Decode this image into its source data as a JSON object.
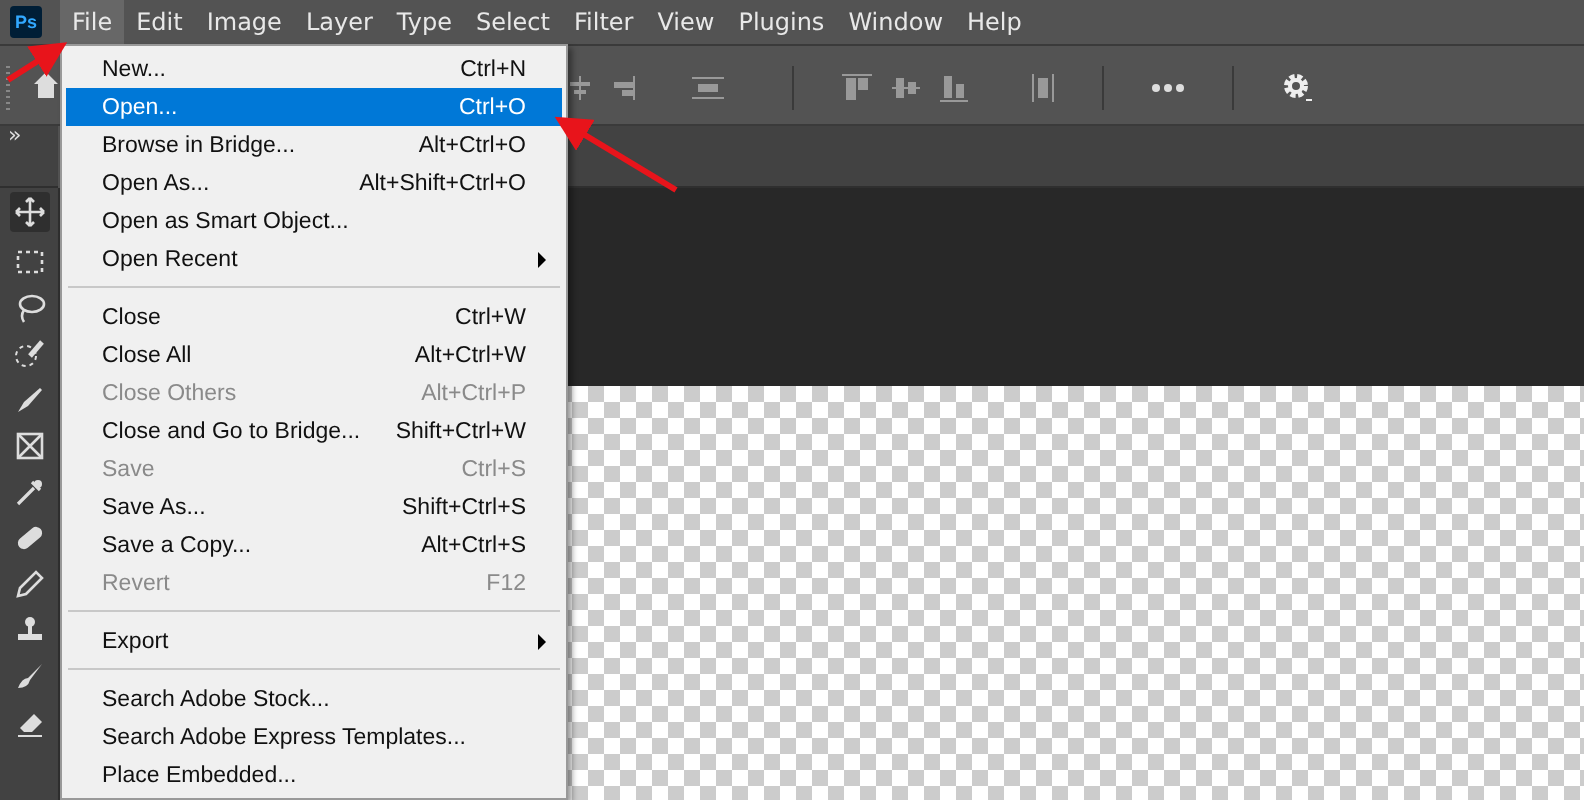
{
  "menubar": [
    {
      "label": "File",
      "selected": true
    },
    {
      "label": "Edit",
      "selected": false
    },
    {
      "label": "Image",
      "selected": false
    },
    {
      "label": "Layer",
      "selected": false
    },
    {
      "label": "Type",
      "selected": false
    },
    {
      "label": "Select",
      "selected": false
    },
    {
      "label": "Filter",
      "selected": false
    },
    {
      "label": "View",
      "selected": false
    },
    {
      "label": "Plugins",
      "selected": false
    },
    {
      "label": "Window",
      "selected": false
    },
    {
      "label": "Help",
      "selected": false
    }
  ],
  "app_logo": "Ps",
  "panel_toggle": "»",
  "file_menu": [
    {
      "kind": "item",
      "label": "New...",
      "shortcut": "Ctrl+N",
      "selected": false,
      "disabled": false
    },
    {
      "kind": "item",
      "label": "Open...",
      "shortcut": "Ctrl+O",
      "selected": true,
      "disabled": false
    },
    {
      "kind": "item",
      "label": "Browse in Bridge...",
      "shortcut": "Alt+Ctrl+O",
      "selected": false,
      "disabled": false
    },
    {
      "kind": "item",
      "label": "Open As...",
      "shortcut": "Alt+Shift+Ctrl+O",
      "selected": false,
      "disabled": false
    },
    {
      "kind": "item",
      "label": "Open as Smart Object...",
      "selected": false,
      "disabled": false
    },
    {
      "kind": "submenu",
      "label": "Open Recent",
      "selected": false,
      "disabled": false
    },
    {
      "kind": "separator"
    },
    {
      "kind": "item",
      "label": "Close",
      "shortcut": "Ctrl+W",
      "selected": false,
      "disabled": false
    },
    {
      "kind": "item",
      "label": "Close All",
      "shortcut": "Alt+Ctrl+W",
      "selected": false,
      "disabled": false
    },
    {
      "kind": "item",
      "label": "Close Others",
      "shortcut": "Alt+Ctrl+P",
      "selected": false,
      "disabled": true
    },
    {
      "kind": "item",
      "label": "Close and Go to Bridge...",
      "shortcut": "Shift+Ctrl+W",
      "selected": false,
      "disabled": false
    },
    {
      "kind": "item",
      "label": "Save",
      "shortcut": "Ctrl+S",
      "selected": false,
      "disabled": true
    },
    {
      "kind": "item",
      "label": "Save As...",
      "shortcut": "Shift+Ctrl+S",
      "selected": false,
      "disabled": false
    },
    {
      "kind": "item",
      "label": "Save a Copy...",
      "shortcut": "Alt+Ctrl+S",
      "selected": false,
      "disabled": false
    },
    {
      "kind": "item",
      "label": "Revert",
      "shortcut": "F12",
      "selected": false,
      "disabled": true
    },
    {
      "kind": "separator"
    },
    {
      "kind": "submenu",
      "label": "Export",
      "selected": false,
      "disabled": false
    },
    {
      "kind": "separator"
    },
    {
      "kind": "item",
      "label": "Search Adobe Stock...",
      "selected": false,
      "disabled": false
    },
    {
      "kind": "item",
      "label": "Search Adobe Express Templates...",
      "selected": false,
      "disabled": false
    },
    {
      "kind": "item",
      "label": "Place Embedded...",
      "selected": false,
      "disabled": false
    }
  ]
}
